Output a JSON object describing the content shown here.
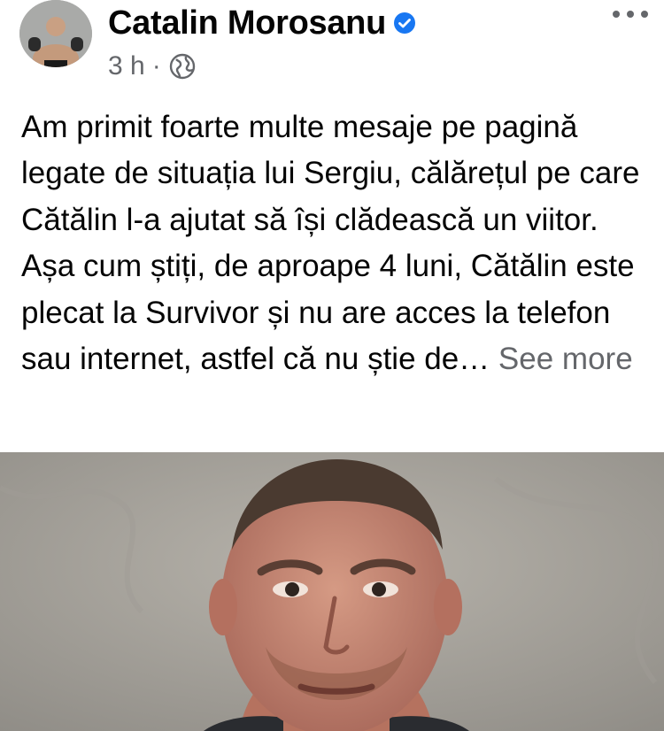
{
  "post": {
    "author": "Catalin Morosanu",
    "time": "3 h",
    "separator": "·",
    "privacy_icon": "globe-icon",
    "verified_icon": "verified-badge-icon",
    "text": "Am primit foarte multe mesaje pe pagină legate de situația lui Sergiu, călărețul pe care Cătălin l-a ajutat să își clădească un viitor. Așa cum știți, de aproape 4 luni, Cătălin este plecat la Survivor și nu are acces la telefon sau internet, astfel că nu știe de…",
    "see_more": "See more"
  },
  "colors": {
    "text": "#050505",
    "secondary": "#65676b",
    "verified": "#1877f2",
    "photo_background": "#a8a59e"
  }
}
